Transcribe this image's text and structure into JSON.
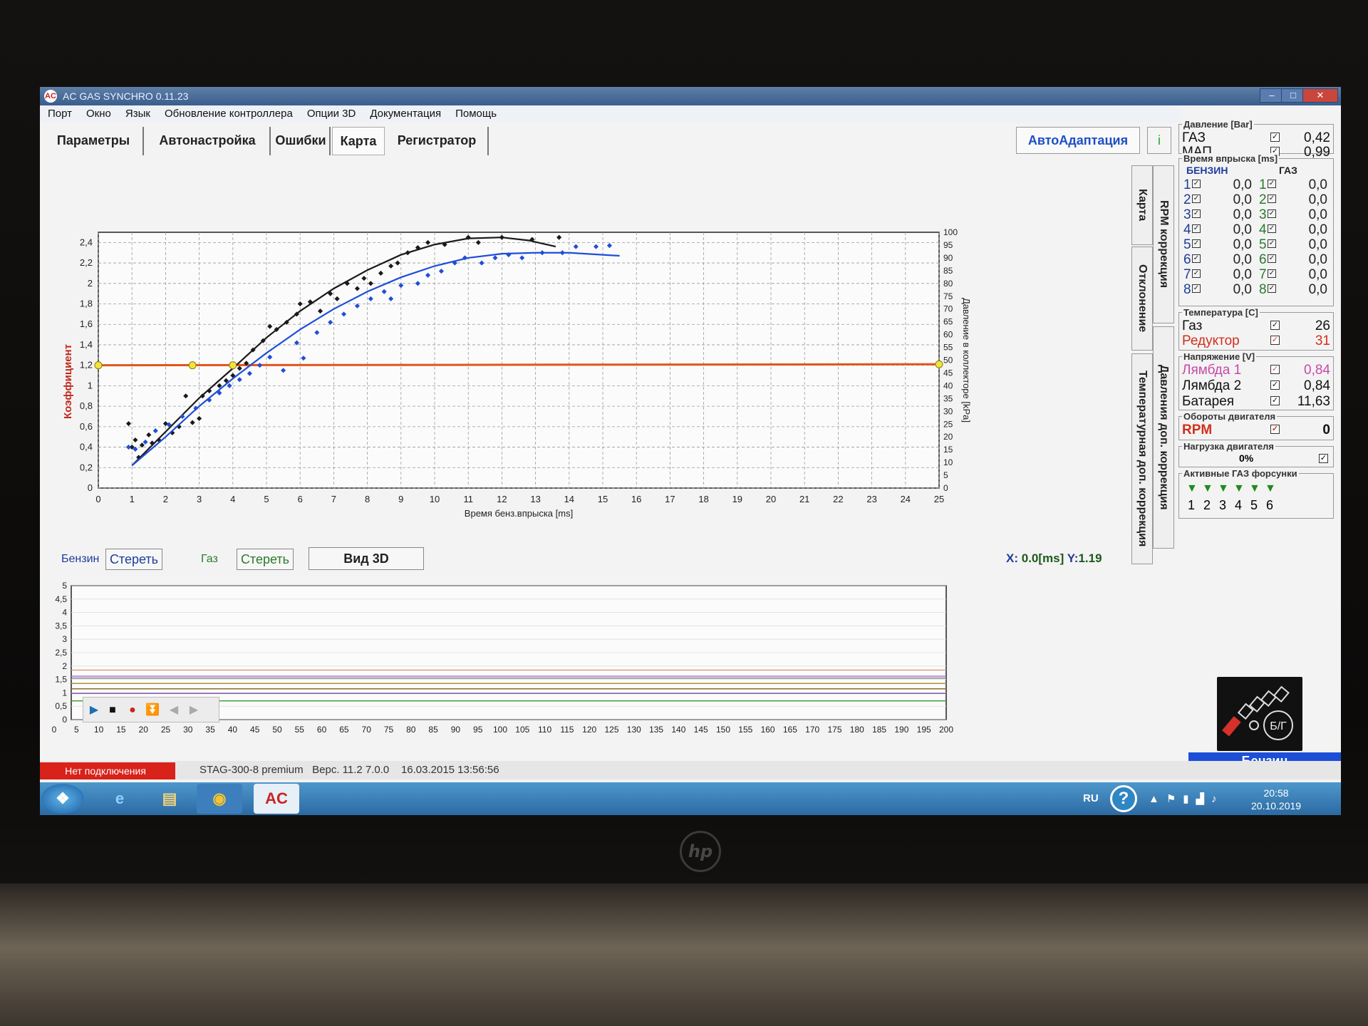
{
  "window": {
    "title": "AC GAS SYNCHRO 0.11.23"
  },
  "menu": [
    "Порт",
    "Окно",
    "Язык",
    "Обновление контроллера",
    "Опции 3D",
    "Документация",
    "Помощь"
  ],
  "tabs": [
    "Параметры",
    "Автонастройка",
    "Ошибки",
    "Карта",
    "Регистратор"
  ],
  "toolbar": {
    "auto_label": "АвтоАдаптация",
    "info_glyph": "i"
  },
  "side_tabs": [
    "Карта",
    "RPM коррекция",
    "Отклонение",
    "Давления доп. коррекция",
    "Температурная доп. коррекция"
  ],
  "controls": {
    "benzin_label": "Бензин",
    "clear_label": "Стереть",
    "gaz_label": "Газ",
    "clear_label_gaz": "Стереть",
    "view3d_label": "Вид 3D",
    "x_key": "X:",
    "x_val": "0.0[ms]",
    "y_key": "Y:",
    "y_val": "1.19"
  },
  "chart_data": {
    "type": "scatter",
    "xlabel": "Время бенз.впрыска [ms]",
    "ylabel": "Коэффициент",
    "y2label": "Давление в коллекторе [kPa]",
    "xlim": [
      0,
      25
    ],
    "ylim": [
      0,
      2.5
    ],
    "y2lim": [
      0,
      100
    ],
    "x_ticks": [
      0,
      1,
      2,
      3,
      4,
      5,
      6,
      7,
      8,
      9,
      10,
      11,
      12,
      13,
      14,
      15,
      16,
      17,
      18,
      19,
      20,
      21,
      22,
      23,
      24,
      25
    ],
    "y_ticks": [
      "0",
      "0,2",
      "0,4",
      "0,6",
      "0,8",
      "1",
      "1,2",
      "1,4",
      "1,6",
      "1,8",
      "2",
      "2,2",
      "2,4"
    ],
    "y2_ticks": [
      0,
      5,
      10,
      15,
      20,
      25,
      30,
      35,
      40,
      45,
      50,
      55,
      60,
      65,
      70,
      75,
      80,
      85,
      90,
      95,
      100
    ],
    "grid": true,
    "series": [
      {
        "color": "#1a1a1a",
        "points": [
          [
            0.9,
            0.63
          ],
          [
            1.0,
            0.4
          ],
          [
            1.1,
            0.47
          ],
          [
            1.2,
            0.3
          ],
          [
            1.3,
            0.42
          ],
          [
            1.5,
            0.52
          ],
          [
            1.6,
            0.44
          ],
          [
            1.8,
            0.47
          ],
          [
            2.0,
            0.63
          ],
          [
            2.2,
            0.54
          ],
          [
            2.4,
            0.6
          ],
          [
            2.6,
            0.9
          ],
          [
            2.8,
            0.64
          ],
          [
            3.0,
            0.68
          ],
          [
            3.1,
            0.9
          ],
          [
            3.3,
            0.95
          ],
          [
            3.6,
            1.0
          ],
          [
            3.8,
            1.05
          ],
          [
            4.0,
            1.1
          ],
          [
            4.2,
            1.17
          ],
          [
            4.4,
            1.22
          ],
          [
            4.6,
            1.35
          ],
          [
            4.9,
            1.44
          ],
          [
            5.1,
            1.58
          ],
          [
            5.3,
            1.55
          ],
          [
            5.6,
            1.62
          ],
          [
            5.9,
            1.7
          ],
          [
            6.0,
            1.8
          ],
          [
            6.3,
            1.82
          ],
          [
            6.6,
            1.73
          ],
          [
            6.9,
            1.9
          ],
          [
            7.1,
            1.85
          ],
          [
            7.4,
            2.0
          ],
          [
            7.7,
            1.95
          ],
          [
            7.9,
            2.05
          ],
          [
            8.1,
            2.0
          ],
          [
            8.4,
            2.1
          ],
          [
            8.7,
            2.17
          ],
          [
            8.9,
            2.2
          ],
          [
            9.2,
            2.3
          ],
          [
            9.5,
            2.35
          ],
          [
            9.8,
            2.4
          ],
          [
            10.3,
            2.38
          ],
          [
            11.0,
            2.45
          ],
          [
            11.3,
            2.4
          ],
          [
            12.0,
            2.45
          ],
          [
            12.9,
            2.43
          ],
          [
            13.7,
            2.45
          ]
        ],
        "fit": [
          [
            1.0,
            0.22
          ],
          [
            2.0,
            0.55
          ],
          [
            3.0,
            0.88
          ],
          [
            4.0,
            1.17
          ],
          [
            5.0,
            1.47
          ],
          [
            6.0,
            1.73
          ],
          [
            7.0,
            1.95
          ],
          [
            8.0,
            2.13
          ],
          [
            9.0,
            2.28
          ],
          [
            10.0,
            2.38
          ],
          [
            11.0,
            2.44
          ],
          [
            12.0,
            2.45
          ],
          [
            12.8,
            2.42
          ],
          [
            13.6,
            2.36
          ]
        ]
      },
      {
        "color": "#1f4ed8",
        "points": [
          [
            0.9,
            0.4
          ],
          [
            1.1,
            0.38
          ],
          [
            1.4,
            0.45
          ],
          [
            1.7,
            0.56
          ],
          [
            2.1,
            0.62
          ],
          [
            2.5,
            0.7
          ],
          [
            2.9,
            0.78
          ],
          [
            3.3,
            0.86
          ],
          [
            3.6,
            0.93
          ],
          [
            3.9,
            1.0
          ],
          [
            4.2,
            1.06
          ],
          [
            4.5,
            1.12
          ],
          [
            4.8,
            1.2
          ],
          [
            5.1,
            1.28
          ],
          [
            5.5,
            1.15
          ],
          [
            5.9,
            1.42
          ],
          [
            6.1,
            1.27
          ],
          [
            6.5,
            1.52
          ],
          [
            6.9,
            1.62
          ],
          [
            7.3,
            1.7
          ],
          [
            7.7,
            1.78
          ],
          [
            8.1,
            1.85
          ],
          [
            8.5,
            1.92
          ],
          [
            8.7,
            1.85
          ],
          [
            9.0,
            1.98
          ],
          [
            9.5,
            2.0
          ],
          [
            9.8,
            2.08
          ],
          [
            10.2,
            2.12
          ],
          [
            10.6,
            2.2
          ],
          [
            10.9,
            2.25
          ],
          [
            11.4,
            2.2
          ],
          [
            11.8,
            2.25
          ],
          [
            12.2,
            2.28
          ],
          [
            12.6,
            2.25
          ],
          [
            13.2,
            2.3
          ],
          [
            13.8,
            2.3
          ],
          [
            14.2,
            2.36
          ],
          [
            14.8,
            2.36
          ],
          [
            15.2,
            2.37
          ]
        ],
        "fit": [
          [
            1.0,
            0.22
          ],
          [
            2.0,
            0.5
          ],
          [
            3.0,
            0.8
          ],
          [
            4.0,
            1.07
          ],
          [
            5.0,
            1.32
          ],
          [
            6.0,
            1.55
          ],
          [
            7.0,
            1.75
          ],
          [
            8.0,
            1.92
          ],
          [
            9.0,
            2.06
          ],
          [
            10.0,
            2.17
          ],
          [
            11.0,
            2.25
          ],
          [
            12.0,
            2.29
          ],
          [
            13.0,
            2.3
          ],
          [
            14.0,
            2.3
          ],
          [
            15.0,
            2.28
          ],
          [
            15.5,
            2.27
          ]
        ]
      }
    ],
    "reference_line": {
      "color": "#e0561b",
      "points": [
        [
          0,
          1.2
        ],
        [
          25,
          1.21
        ]
      ]
    },
    "markers": [
      [
        0,
        1.2
      ],
      [
        2.8,
        1.2
      ],
      [
        4.0,
        1.2
      ],
      [
        25,
        1.21
      ]
    ]
  },
  "recorder": {
    "y_ticks": [
      "0",
      "0,5",
      "1",
      "1,5",
      "2",
      "2,5",
      "3",
      "3,5",
      "4",
      "4,5",
      "5"
    ],
    "x_ticks": [
      0,
      5,
      10,
      15,
      20,
      25,
      30,
      35,
      40,
      45,
      50,
      55,
      60,
      65,
      70,
      75,
      80,
      85,
      90,
      95,
      100,
      105,
      110,
      115,
      120,
      125,
      130,
      135,
      140,
      145,
      150,
      155,
      160,
      165,
      170,
      175,
      180,
      185,
      190,
      195,
      200
    ]
  },
  "panel": {
    "pressure": {
      "title": "Давление [Bar]",
      "rows": [
        {
          "name": "ГАЗ",
          "value": "0,42",
          "color": "#111"
        },
        {
          "name": "МАП",
          "value": "0,99",
          "color": "#111"
        }
      ]
    },
    "injection": {
      "title": "Время впрыска [ms]",
      "col_benzin": "БЕНЗИН",
      "col_gaz": "ГАЗ",
      "benzin": [
        "0,0",
        "0,0",
        "0,0",
        "0,0",
        "0,0",
        "0,0",
        "0,0",
        "0,0"
      ],
      "gaz": [
        "0,0",
        "0,0",
        "0,0",
        "0,0",
        "0,0",
        "0,0",
        "0,0",
        "0,0"
      ],
      "nums": [
        "1",
        "2",
        "3",
        "4",
        "5",
        "6",
        "7",
        "8"
      ]
    },
    "temperature": {
      "title": "Температура [C]",
      "rows": [
        {
          "name": "Газ",
          "value": "26",
          "color": "#111"
        },
        {
          "name": "Редуктор",
          "value": "31",
          "color": "#d0301c"
        }
      ]
    },
    "voltage": {
      "title": "Напряжение [V]",
      "rows": [
        {
          "name": "Лямбда 1",
          "value": "0,84",
          "color": "#c54aa8"
        },
        {
          "name": "Лямбда 2",
          "value": "0,84",
          "color": "#111"
        },
        {
          "name": "Батарея",
          "value": "11,63",
          "color": "#111"
        }
      ]
    },
    "rpm": {
      "title": "Обороты двигателя",
      "name": "RPM",
      "value": "0"
    },
    "load": {
      "title": "Нагрузка двигателя",
      "value": "0%"
    },
    "active": {
      "title": "Активные ГАЗ форсунки",
      "nums": [
        "1",
        "2",
        "3",
        "4",
        "5",
        "6"
      ]
    }
  },
  "fuel": {
    "label": "Бензин",
    "badge": "Б/Г"
  },
  "status": {
    "connection": "Нет подключения",
    "device": "STAG-300-8 premium",
    "version": "Верс. 11.2  7.0.0",
    "date": "16.03.2015 13:56:56"
  },
  "taskbar": {
    "lang": "RU",
    "time": "20:58",
    "date": "20.10.2019"
  }
}
